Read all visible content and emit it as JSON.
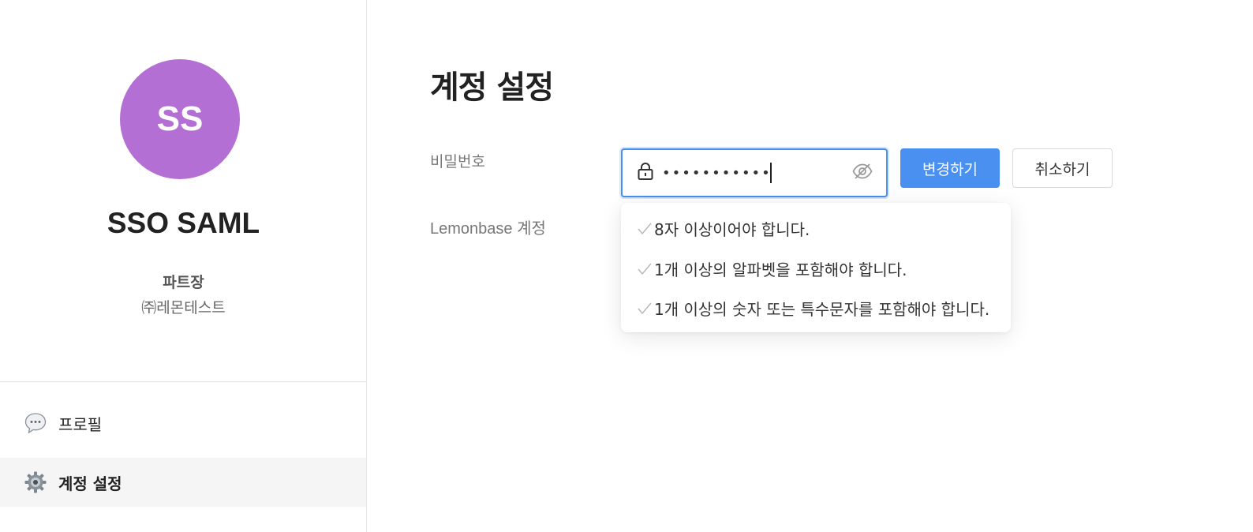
{
  "sidebar": {
    "avatar_initials": "SS",
    "user_name": "SSO SAML",
    "role": "파트장",
    "company": "㈜레몬테스트",
    "nav": [
      {
        "label": "프로필",
        "icon": "speech-bubble-icon"
      },
      {
        "label": "계정 설정",
        "icon": "gear-icon"
      }
    ]
  },
  "main": {
    "title": "계정 설정",
    "password_label": "비밀번호",
    "lemonbase_label": "Lemonbase 계정",
    "password_value": "•••••••••••",
    "change_button": "변경하기",
    "cancel_button": "취소하기",
    "password_rules": [
      "8자 이상이어야 합니다.",
      "1개 이상의 알파벳을 포함해야 합니다.",
      "1개 이상의 숫자 또는 특수문자를 포함해야 합니다."
    ]
  },
  "colors": {
    "avatar": "#b36fd3",
    "primary": "#4a90f0",
    "active_nav_bg": "#f5f5f5"
  }
}
